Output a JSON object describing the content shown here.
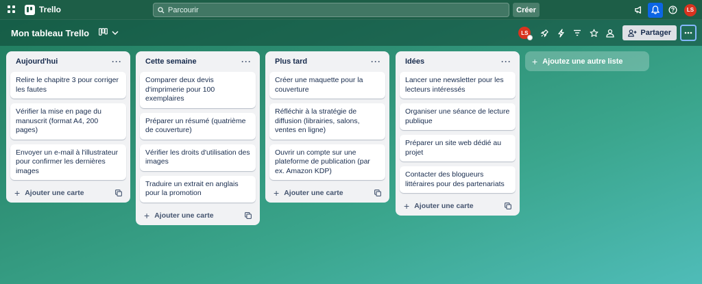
{
  "app": {
    "name": "Trello"
  },
  "search": {
    "placeholder": "Parcourir"
  },
  "topbar": {
    "create_label": "Créer",
    "avatar_initials": "LS"
  },
  "board": {
    "title": "Mon tableau Trello",
    "avatar_initials": "LS",
    "share_label": "Partager"
  },
  "lists": [
    {
      "title": "Aujourd'hui",
      "cards": [
        "Relire le chapitre 3 pour corriger les fautes",
        "Vérifier la mise en page du manuscrit (format A4, 200 pages)",
        "Envoyer un e-mail à l'illustrateur pour confirmer les dernières images"
      ],
      "add_label": "Ajouter une carte"
    },
    {
      "title": "Cette semaine",
      "cards": [
        "Comparer deux devis d'imprimerie pour 100 exemplaires",
        "Préparer un résumé (quatrième de couverture)",
        "Vérifier les droits d'utilisation des images",
        "Traduire un extrait en anglais pour la promotion"
      ],
      "add_label": "Ajouter une carte"
    },
    {
      "title": "Plus tard",
      "cards": [
        "Créer une maquette pour la couverture",
        "Réfléchir à la stratégie de diffusion (librairies, salons, ventes en ligne)",
        "Ouvrir un compte sur une plateforme de publication (par ex. Amazon KDP)"
      ],
      "add_label": "Ajouter une carte"
    },
    {
      "title": "Idées",
      "cards": [
        "Lancer une newsletter pour les lecteurs intéressés",
        "Organiser une séance de lecture publique",
        "Préparer un site web dédié au projet",
        "Contacter des blogueurs littéraires pour des partenariats"
      ],
      "add_label": "Ajouter une carte"
    }
  ],
  "add_list_label": "Ajoutez une autre liste",
  "colors": {
    "topbar": "#1d5e47",
    "active_icon": "#0c66e4",
    "avatar": "#d9331f"
  }
}
